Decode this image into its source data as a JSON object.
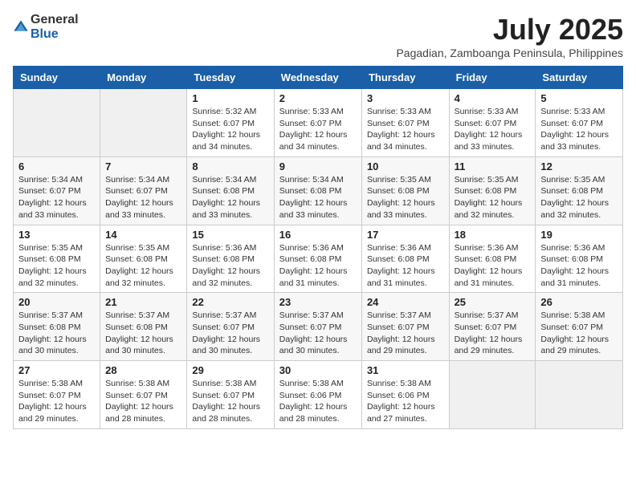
{
  "logo": {
    "general": "General",
    "blue": "Blue"
  },
  "title": "July 2025",
  "location": "Pagadian, Zamboanga Peninsula, Philippines",
  "weekdays": [
    "Sunday",
    "Monday",
    "Tuesday",
    "Wednesday",
    "Thursday",
    "Friday",
    "Saturday"
  ],
  "weeks": [
    [
      {
        "day": "",
        "sunrise": "",
        "sunset": "",
        "daylight": ""
      },
      {
        "day": "",
        "sunrise": "",
        "sunset": "",
        "daylight": ""
      },
      {
        "day": "1",
        "sunrise": "Sunrise: 5:32 AM",
        "sunset": "Sunset: 6:07 PM",
        "daylight": "Daylight: 12 hours and 34 minutes."
      },
      {
        "day": "2",
        "sunrise": "Sunrise: 5:33 AM",
        "sunset": "Sunset: 6:07 PM",
        "daylight": "Daylight: 12 hours and 34 minutes."
      },
      {
        "day": "3",
        "sunrise": "Sunrise: 5:33 AM",
        "sunset": "Sunset: 6:07 PM",
        "daylight": "Daylight: 12 hours and 34 minutes."
      },
      {
        "day": "4",
        "sunrise": "Sunrise: 5:33 AM",
        "sunset": "Sunset: 6:07 PM",
        "daylight": "Daylight: 12 hours and 33 minutes."
      },
      {
        "day": "5",
        "sunrise": "Sunrise: 5:33 AM",
        "sunset": "Sunset: 6:07 PM",
        "daylight": "Daylight: 12 hours and 33 minutes."
      }
    ],
    [
      {
        "day": "6",
        "sunrise": "Sunrise: 5:34 AM",
        "sunset": "Sunset: 6:07 PM",
        "daylight": "Daylight: 12 hours and 33 minutes."
      },
      {
        "day": "7",
        "sunrise": "Sunrise: 5:34 AM",
        "sunset": "Sunset: 6:07 PM",
        "daylight": "Daylight: 12 hours and 33 minutes."
      },
      {
        "day": "8",
        "sunrise": "Sunrise: 5:34 AM",
        "sunset": "Sunset: 6:08 PM",
        "daylight": "Daylight: 12 hours and 33 minutes."
      },
      {
        "day": "9",
        "sunrise": "Sunrise: 5:34 AM",
        "sunset": "Sunset: 6:08 PM",
        "daylight": "Daylight: 12 hours and 33 minutes."
      },
      {
        "day": "10",
        "sunrise": "Sunrise: 5:35 AM",
        "sunset": "Sunset: 6:08 PM",
        "daylight": "Daylight: 12 hours and 33 minutes."
      },
      {
        "day": "11",
        "sunrise": "Sunrise: 5:35 AM",
        "sunset": "Sunset: 6:08 PM",
        "daylight": "Daylight: 12 hours and 32 minutes."
      },
      {
        "day": "12",
        "sunrise": "Sunrise: 5:35 AM",
        "sunset": "Sunset: 6:08 PM",
        "daylight": "Daylight: 12 hours and 32 minutes."
      }
    ],
    [
      {
        "day": "13",
        "sunrise": "Sunrise: 5:35 AM",
        "sunset": "Sunset: 6:08 PM",
        "daylight": "Daylight: 12 hours and 32 minutes."
      },
      {
        "day": "14",
        "sunrise": "Sunrise: 5:35 AM",
        "sunset": "Sunset: 6:08 PM",
        "daylight": "Daylight: 12 hours and 32 minutes."
      },
      {
        "day": "15",
        "sunrise": "Sunrise: 5:36 AM",
        "sunset": "Sunset: 6:08 PM",
        "daylight": "Daylight: 12 hours and 32 minutes."
      },
      {
        "day": "16",
        "sunrise": "Sunrise: 5:36 AM",
        "sunset": "Sunset: 6:08 PM",
        "daylight": "Daylight: 12 hours and 31 minutes."
      },
      {
        "day": "17",
        "sunrise": "Sunrise: 5:36 AM",
        "sunset": "Sunset: 6:08 PM",
        "daylight": "Daylight: 12 hours and 31 minutes."
      },
      {
        "day": "18",
        "sunrise": "Sunrise: 5:36 AM",
        "sunset": "Sunset: 6:08 PM",
        "daylight": "Daylight: 12 hours and 31 minutes."
      },
      {
        "day": "19",
        "sunrise": "Sunrise: 5:36 AM",
        "sunset": "Sunset: 6:08 PM",
        "daylight": "Daylight: 12 hours and 31 minutes."
      }
    ],
    [
      {
        "day": "20",
        "sunrise": "Sunrise: 5:37 AM",
        "sunset": "Sunset: 6:08 PM",
        "daylight": "Daylight: 12 hours and 30 minutes."
      },
      {
        "day": "21",
        "sunrise": "Sunrise: 5:37 AM",
        "sunset": "Sunset: 6:08 PM",
        "daylight": "Daylight: 12 hours and 30 minutes."
      },
      {
        "day": "22",
        "sunrise": "Sunrise: 5:37 AM",
        "sunset": "Sunset: 6:07 PM",
        "daylight": "Daylight: 12 hours and 30 minutes."
      },
      {
        "day": "23",
        "sunrise": "Sunrise: 5:37 AM",
        "sunset": "Sunset: 6:07 PM",
        "daylight": "Daylight: 12 hours and 30 minutes."
      },
      {
        "day": "24",
        "sunrise": "Sunrise: 5:37 AM",
        "sunset": "Sunset: 6:07 PM",
        "daylight": "Daylight: 12 hours and 29 minutes."
      },
      {
        "day": "25",
        "sunrise": "Sunrise: 5:37 AM",
        "sunset": "Sunset: 6:07 PM",
        "daylight": "Daylight: 12 hours and 29 minutes."
      },
      {
        "day": "26",
        "sunrise": "Sunrise: 5:38 AM",
        "sunset": "Sunset: 6:07 PM",
        "daylight": "Daylight: 12 hours and 29 minutes."
      }
    ],
    [
      {
        "day": "27",
        "sunrise": "Sunrise: 5:38 AM",
        "sunset": "Sunset: 6:07 PM",
        "daylight": "Daylight: 12 hours and 29 minutes."
      },
      {
        "day": "28",
        "sunrise": "Sunrise: 5:38 AM",
        "sunset": "Sunset: 6:07 PM",
        "daylight": "Daylight: 12 hours and 28 minutes."
      },
      {
        "day": "29",
        "sunrise": "Sunrise: 5:38 AM",
        "sunset": "Sunset: 6:07 PM",
        "daylight": "Daylight: 12 hours and 28 minutes."
      },
      {
        "day": "30",
        "sunrise": "Sunrise: 5:38 AM",
        "sunset": "Sunset: 6:06 PM",
        "daylight": "Daylight: 12 hours and 28 minutes."
      },
      {
        "day": "31",
        "sunrise": "Sunrise: 5:38 AM",
        "sunset": "Sunset: 6:06 PM",
        "daylight": "Daylight: 12 hours and 27 minutes."
      },
      {
        "day": "",
        "sunrise": "",
        "sunset": "",
        "daylight": ""
      },
      {
        "day": "",
        "sunrise": "",
        "sunset": "",
        "daylight": ""
      }
    ]
  ]
}
